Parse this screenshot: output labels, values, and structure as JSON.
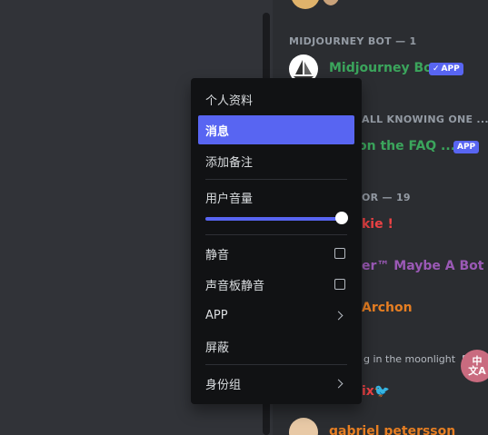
{
  "members": {
    "category_midjourney": "MIDJOURNEY BOT — 1",
    "midjourney_name": "Midjourney Bot",
    "app_badge": "APP",
    "category_all_knowing": "ALL KNOWING ONE ...",
    "faq_name": "on the FAQ ...",
    "category_or": "OR — 19",
    "member_1": "kie !",
    "member_2": "er™ Maybe A Bot",
    "member_3": "Archon",
    "member_3_status": "g in the moonlight",
    "member_4": "ix🐦",
    "member_5": "gabriel petersson",
    "colors": {
      "midjourney": "#3ba55c",
      "faq": "#3ba55c",
      "member_1": "#ed4245",
      "member_2": "#9b59b6",
      "member_3": "#e67e22",
      "member_4": "#ed4245",
      "member_5": "#e67e22"
    }
  },
  "translate_bubble": {
    "line1": "中",
    "line2": "文A"
  },
  "context_menu": {
    "profile": "个人资料",
    "message": "消息",
    "add_note": "添加备注",
    "user_volume": "用户音量",
    "volume_level": 1.0,
    "mute": "静音",
    "soundboard_mute": "声音板静音",
    "app": "APP",
    "block": "屏蔽",
    "roles": "身份组",
    "accent": "#5865f2"
  }
}
